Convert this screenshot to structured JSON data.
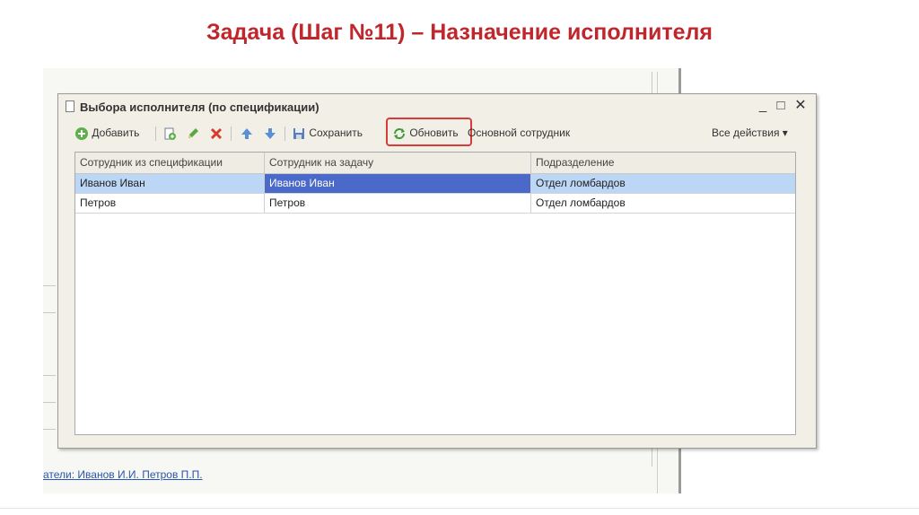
{
  "slide": {
    "title": "Задача (Шаг №11) – Назначение исполнителя"
  },
  "background_form": {
    "footer_link": "атели: Иванов И.И. Петров П.П."
  },
  "dialog": {
    "title": "Выбора исполнителя (по спецификации)",
    "window_controls": {
      "minimize": "_",
      "maximize": "□",
      "close": "✕"
    },
    "toolbar": {
      "add_label": "Добавить",
      "save_label": "Сохранить",
      "refresh_label": "Обновить",
      "main_employee_label": "Основной сотрудник",
      "all_actions_label": "Все действия ▾",
      "icons": [
        "add-icon",
        "copy-icon",
        "edit-icon",
        "delete-icon",
        "move-up-icon",
        "move-down-icon",
        "save-icon",
        "refresh-icon"
      ]
    },
    "table": {
      "columns": [
        "Сотрудник из спецификации",
        "Сотрудник на задачу",
        "Подразделение"
      ],
      "rows": [
        {
          "spec_employee": "Иванов Иван",
          "task_employee": "Иванов Иван",
          "department": "Отдел ломбардов"
        },
        {
          "spec_employee": "Петров",
          "task_employee": "Петров",
          "department": "Отдел ломбардов"
        }
      ]
    }
  },
  "colors": {
    "title_red": "#c0272d",
    "highlight_red": "#d93a3a",
    "selected_row": "#bcd6f6",
    "active_cell": "#4a69c8"
  }
}
